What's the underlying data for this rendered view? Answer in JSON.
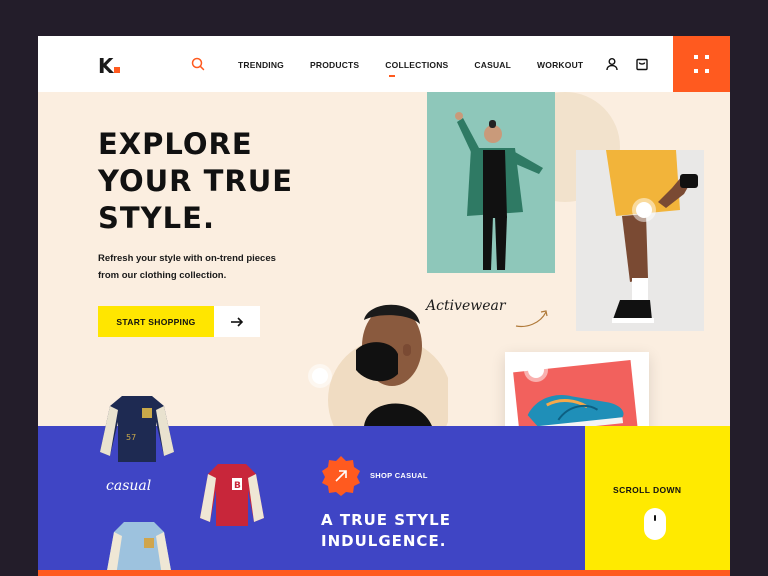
{
  "brand": {
    "logo_text": "K",
    "accent": "#ff5a1f"
  },
  "nav": {
    "items": [
      {
        "label": "TRENDING",
        "active": false
      },
      {
        "label": "PRODUCTS",
        "active": false
      },
      {
        "label": "COLLECTIONS",
        "active": true
      },
      {
        "label": "CASUAL",
        "active": false
      },
      {
        "label": "WORKOUT",
        "active": false
      }
    ],
    "icons": [
      "search-icon",
      "user-icon",
      "cart-icon",
      "grid-menu-icon"
    ]
  },
  "hero": {
    "headline_1": "EXPLORE",
    "headline_2": "YOUR TRUE",
    "headline_3": "STYLE.",
    "sub_1": "Refresh your style with on-trend pieces",
    "sub_2": "from our clothing collection.",
    "cta_label": "START SHOPPING"
  },
  "tags": {
    "activewear": "Activewear",
    "casual": "casual"
  },
  "promo": {
    "shop_label": "SHOP CASUAL",
    "tagline_1": "A TRUE STYLE",
    "tagline_2": "INDULGENCE."
  },
  "scroll": {
    "label": "SCROLL DOWN"
  },
  "colors": {
    "orange": "#ff5a1f",
    "yellow": "#ffe600",
    "blue": "#3f45c5",
    "cream": "#fbeee0"
  }
}
